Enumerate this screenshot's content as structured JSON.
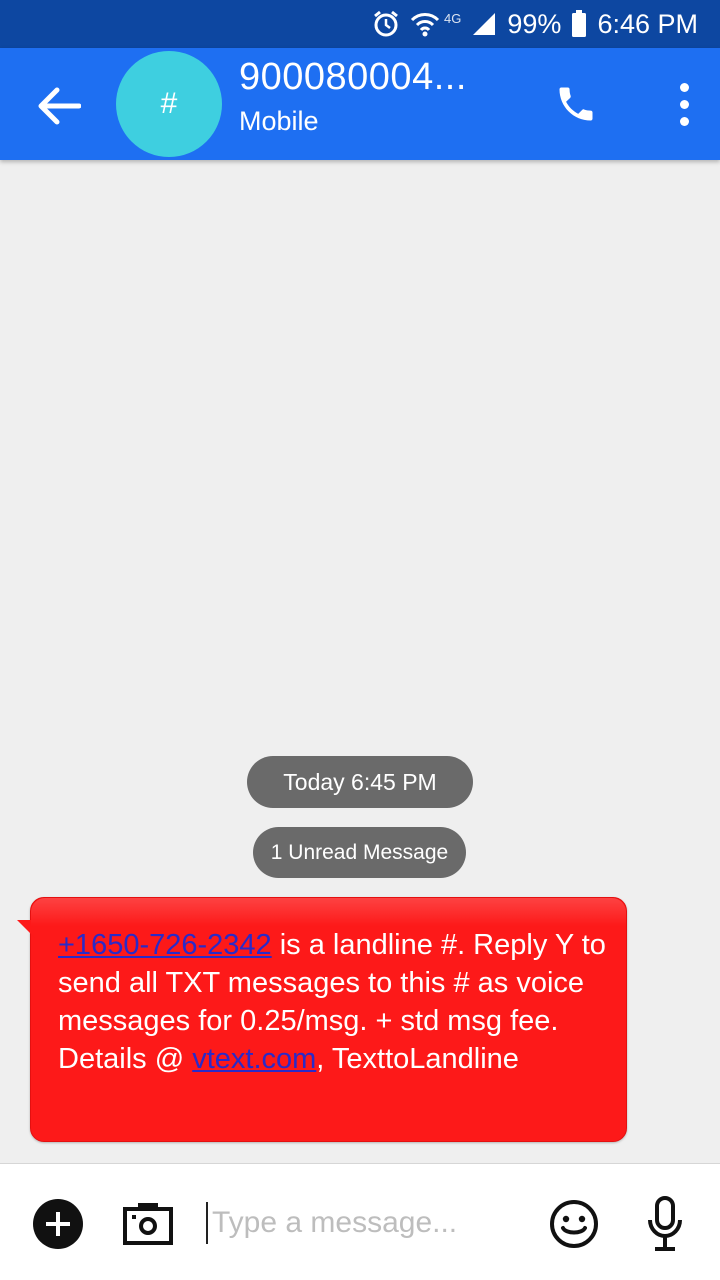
{
  "status_bar": {
    "network_label": "4G",
    "battery_percent": "99%",
    "time": "6:46 PM"
  },
  "header": {
    "avatar_glyph": "#",
    "contact_name": "900080004...",
    "contact_sub": "Mobile",
    "accent_color": "#1e6ff2"
  },
  "conversation": {
    "date_chip": "Today 6:45 PM",
    "unread_chip": "1 Unread Message",
    "message": {
      "link_number": "+1650-726-2342",
      "text_a": " is a landline #. Reply Y to send all TXT messages to this # as voice messages for 0.25/msg. + std msg fee. Details @ ",
      "link_site": "vtext.com",
      "text_b": ", TexttoLandline",
      "bubble_color": "#fd1919"
    }
  },
  "composer": {
    "placeholder": "Type a message..."
  }
}
